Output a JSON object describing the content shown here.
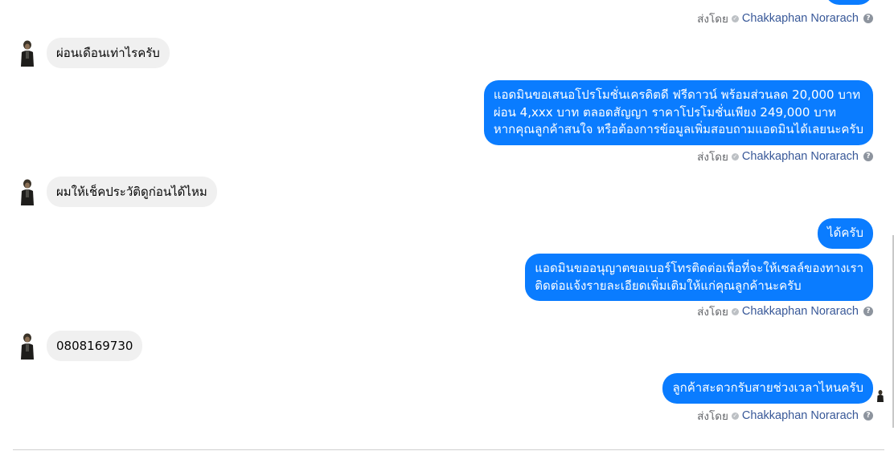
{
  "sent_by_label": "ส่งโดย",
  "sender_name": "Chakkaphan Norarach",
  "colors": {
    "outgoing_bubble": "#0a7cff",
    "incoming_bubble": "#f0f0f0",
    "link": "#385898"
  },
  "messages": {
    "m1": {
      "text": "ผ่อนเดือนเท่าไรครับ"
    },
    "m2": {
      "lines": [
        "แอดมินขอเสนอโปรโมชั่นเครดิตดี ฟรีดาวน์ พร้อมส่วนลด 20,000 บาท",
        "ผ่อน 4,xxx บาท ตลอดสัญญา ราคาโปรโมชั่นเพียง 249,000 บาท",
        "หากคุณลูกค้าสนใจ หรือต้องการข้อมูลเพิ่มสอบถามแอดมินได้เลยนะครับ"
      ]
    },
    "m3": {
      "text": "ผมให้เช็คประวัติดูก่อนได้ไหม"
    },
    "m4": {
      "text": "ได้ครับ"
    },
    "m5": {
      "lines": [
        "แอดมินขออนุญาตขอเบอร์โทรติดต่อเพื่อที่จะให้เซลล์ของทางเรา",
        "ติดต่อแจ้งรายละเอียดเพิ่มเติมให้แก่คุณลูกค้านะครับ"
      ]
    },
    "m6": {
      "text": "0808169730"
    },
    "m7": {
      "text": "ลูกค้าสะดวกรับสายช่วงเวลาไหนครับ"
    }
  },
  "icons": {
    "sent_check": "check-circle-icon",
    "help": "help-circle-icon",
    "avatar": "user-avatar"
  }
}
